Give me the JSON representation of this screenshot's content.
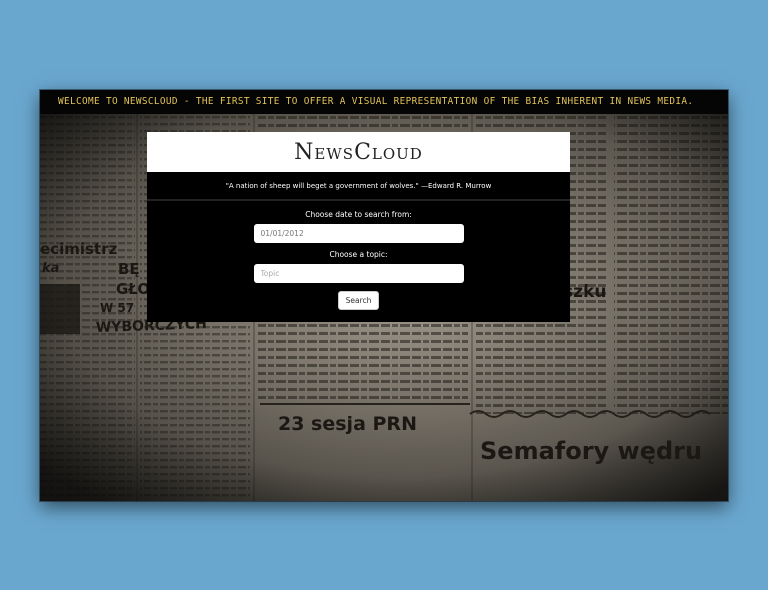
{
  "ticker": {
    "text": "WELCOME TO NEWSCLOUD - THE FIRST SITE TO OFFER A VISUAL REPRESENTATION OF THE BIAS INHERENT IN NEWS MEDIA."
  },
  "header": {
    "logo": "NewsCloud",
    "quote": "\"A nation of sheep will beget a government of wolves.\" —Edward R. Murrow"
  },
  "form": {
    "date_label": "Choose date to search from:",
    "date_value": "01/01/2012",
    "topic_label": "Choose a topic:",
    "topic_placeholder": "Topic",
    "search_label": "Search"
  },
  "background": {
    "headline_1": "23 sesja PRN",
    "headline_2": "Semafory wędru",
    "headline_3": "WYBORCZYCH",
    "headline_4": "ecimistrz",
    "headline_5": "szku",
    "headline_6": "W 57",
    "headline_7": "BĘ",
    "headline_8": "GŁO",
    "headline_9": "ka"
  },
  "colors": {
    "page_bg": "#6aa7cf",
    "ticker_text": "#e3c45a",
    "card_bg": "#000000"
  }
}
